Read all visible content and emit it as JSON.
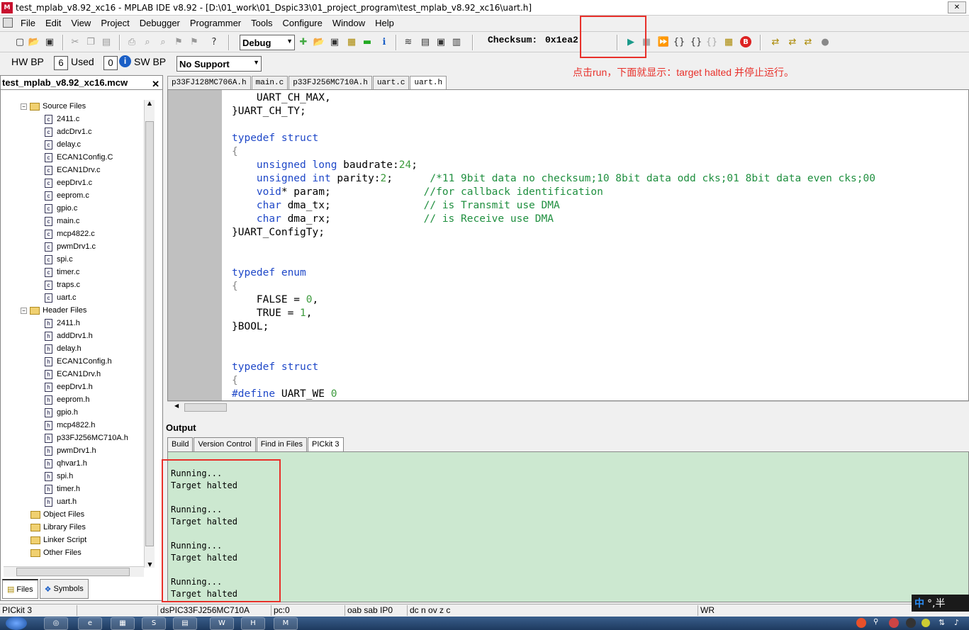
{
  "window": {
    "title": "test_mplab_v8.92_xc16 - MPLAB IDE v8.92 - [D:\\01_work\\01_Dspic33\\01_project_program\\test_mplab_v8.92_xc16\\uart.h]"
  },
  "menu": [
    "File",
    "Edit",
    "View",
    "Project",
    "Debugger",
    "Programmer",
    "Tools",
    "Configure",
    "Window",
    "Help"
  ],
  "toolbar": {
    "config_select": "Debug",
    "checksum_label": "Checksum:",
    "checksum_value": "0x1ea2"
  },
  "breakpoints": {
    "hw_label": "HW BP",
    "hw_count": "6",
    "used_label": "Used",
    "used_count": "0",
    "sw_label": "SW BP",
    "sw_select": "No Support"
  },
  "annotation": "点击run，下面就显示：target halted 并停止运行。",
  "workspace": {
    "title": "test_mplab_v8.92_xc16.mcw",
    "source_folder": "Source Files",
    "source_files": [
      "2411.c",
      "adcDrv1.c",
      "delay.c",
      "ECAN1Config.C",
      "ECAN1Drv.c",
      "eepDrv1.c",
      "eeprom.c",
      "gpio.c",
      "main.c",
      "mcp4822.c",
      "pwmDrv1.c",
      "spi.c",
      "timer.c",
      "traps.c",
      "uart.c"
    ],
    "header_folder": "Header Files",
    "header_files": [
      "2411.h",
      "addDrv1.h",
      "delay.h",
      "ECAN1Config.h",
      "ECAN1Drv.h",
      "eepDrv1.h",
      "eeprom.h",
      "gpio.h",
      "mcp4822.h",
      "p33FJ256MC710A.h",
      "pwmDrv1.h",
      "qhvar1.h",
      "spi.h",
      "timer.h",
      "uart.h"
    ],
    "other_folders": [
      "Object Files",
      "Library Files",
      "Linker Script",
      "Other Files"
    ],
    "tabs": [
      "Files",
      "Symbols"
    ]
  },
  "editor": {
    "tabs": [
      "p33FJ128MC706A.h",
      "main.c",
      "p33FJ256MC710A.h",
      "uart.c",
      "uart.h"
    ],
    "active_tab": "uart.h"
  },
  "output": {
    "title": "Output",
    "tabs": [
      "Build",
      "Version Control",
      "Find in Files",
      "PICkit 3"
    ],
    "active_tab": "PICkit 3",
    "lines": [
      "Running...",
      "Target halted",
      "",
      "Running...",
      "Target halted",
      "",
      "Running...",
      "Target halted",
      "",
      "Running...",
      "Target halted"
    ]
  },
  "status": {
    "tool": "PICkit 3",
    "device": "dsPIC33FJ256MC710A",
    "pc": "pc:0",
    "regs": "oab sab IP0",
    "flags": "dc n ov z c",
    "mode": "WR"
  },
  "ime": {
    "lang": "中",
    "punct": "°,半"
  }
}
